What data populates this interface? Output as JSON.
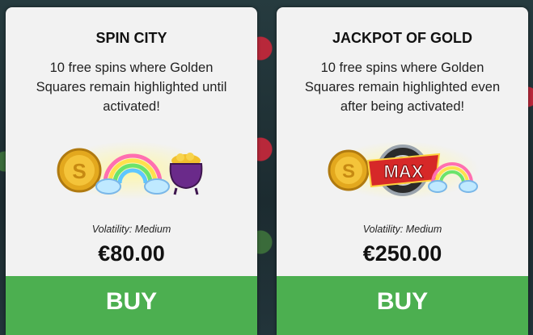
{
  "cards": [
    {
      "title": "SPIN CITY",
      "description": "10 free spins where Golden Squares remain highlighted until activated!",
      "volatility": "Volatility: Medium",
      "price": "€80.00",
      "buy_label": "BUY",
      "icons": [
        "gold-coin-icon",
        "rainbow-icon",
        "pot-of-gold-icon"
      ]
    },
    {
      "title": "JACKPOT OF GOLD",
      "description": "10 free spins where Golden Squares remain highlighted even after being activated!",
      "volatility": "Volatility: Medium",
      "price": "€250.00",
      "buy_label": "BUY",
      "icons": [
        "gold-coin-icon",
        "max-badge-icon",
        "rainbow-icon"
      ],
      "badge_text": "MAX"
    }
  ],
  "colors": {
    "buy_button": "#4caf50",
    "card_background": "#f2f2f2"
  }
}
